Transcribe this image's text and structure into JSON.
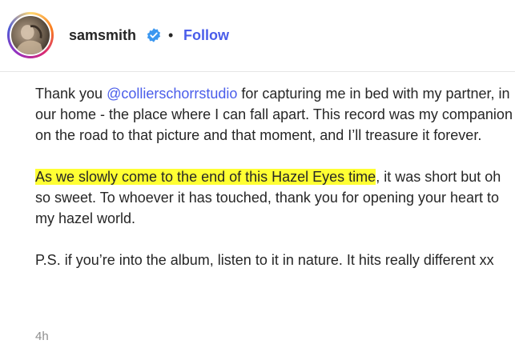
{
  "header": {
    "username": "samsmith",
    "separator": "•",
    "follow_label": "Follow",
    "colors": {
      "follow": "#4a5dea",
      "verified": "#3b97f0"
    }
  },
  "caption": {
    "p1_pre": "Thank you ",
    "p1_mention": "@collierschorrstudio",
    "p1_post": " for capturing me in bed with my partner, in our home - the place where I can fall apart. This record was my companion on the road to that picture and that moment, and I’ll treasure it forever.",
    "p2_highlight": "As we slowly come to the end of this Hazel Eyes time",
    "p2_post": ", it was short but oh so sweet. To whoever it has touched, thank you for opening your heart to my hazel world.",
    "p3": "P.S. if you’re into the album, listen to it in nature. It hits really different xx"
  },
  "timestamp": "4h"
}
